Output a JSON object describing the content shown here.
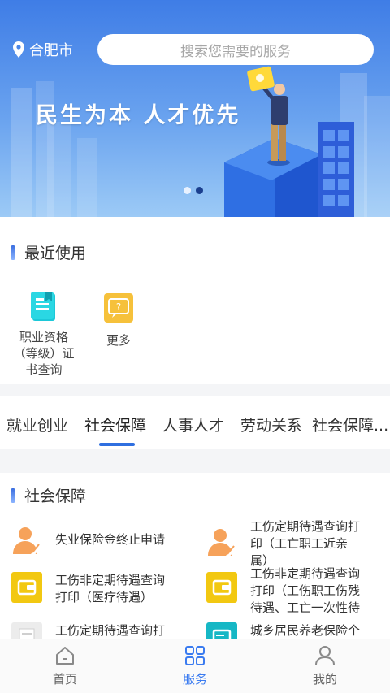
{
  "header": {
    "location": "合肥市",
    "search_placeholder": "搜索您需要的服务"
  },
  "banner": {
    "slogan": "民生为本 人才优先",
    "dots": 2,
    "active_dot": 2
  },
  "recent": {
    "title": "最近使用",
    "items": [
      {
        "label_lines": [
          "职业资格",
          "（等级）证",
          "书查询"
        ],
        "icon": "certificate-icon"
      },
      {
        "label_lines": [
          "更多"
        ],
        "icon": "more-icon"
      }
    ]
  },
  "tabs": {
    "items": [
      "就业创业",
      "社会保障",
      "人事人才",
      "劳动关系",
      "社会保障..."
    ],
    "active": "社会保障"
  },
  "social": {
    "title": "社会保障",
    "services": [
      {
        "lines": [
          "失业保险金终止申请"
        ],
        "icon": "person-edit-icon"
      },
      {
        "lines": [
          "工伤定期待遇查询打",
          "印（工亡职工近亲",
          "属）"
        ],
        "icon": "person-edit-icon"
      },
      {
        "lines": [
          "工伤非定期待遇查询",
          "打印（医疗待遇）"
        ],
        "icon": "wallet-icon"
      },
      {
        "lines": [
          "工伤非定期待遇查询",
          "打印（工伤职工伤残",
          "待遇、工亡一次性待"
        ],
        "icon": "wallet-icon"
      },
      {
        "lines": [
          "工伤定期待遇查询打"
        ],
        "icon": "document-icon"
      },
      {
        "lines": [
          "城乡居民养老保险个"
        ],
        "icon": "card-icon"
      }
    ]
  },
  "nav": {
    "items": [
      {
        "label": "首页",
        "icon": "home-icon"
      },
      {
        "label": "服务",
        "icon": "grid-icon"
      },
      {
        "label": "我的",
        "icon": "user-icon"
      }
    ],
    "active": "服务"
  },
  "colors": {
    "accent": "#3a7bf0",
    "banner_top": "#3f7de6",
    "banner_bottom": "#9ccaf6",
    "yellow_icon": "#f2c811",
    "orange_icon": "#f6a25a"
  }
}
